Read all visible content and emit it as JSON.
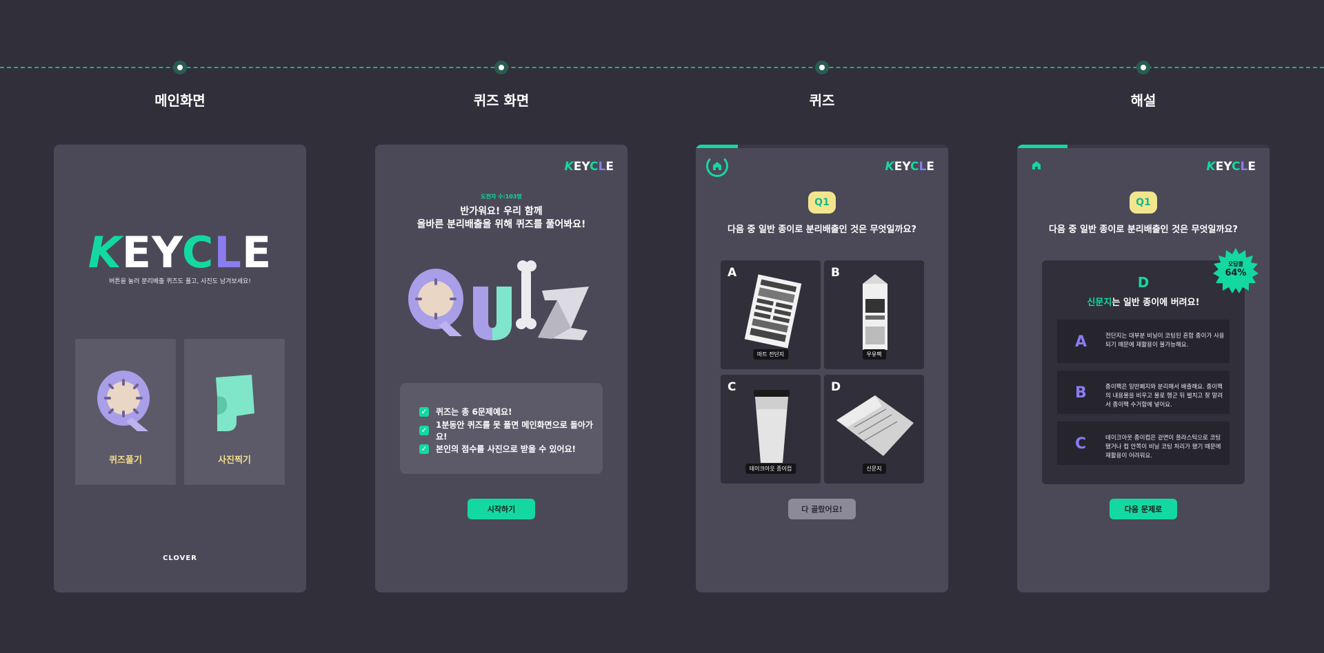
{
  "steps": [
    {
      "title": "메인화면"
    },
    {
      "title": "퀴즈 화면"
    },
    {
      "title": "퀴즈"
    },
    {
      "title": "해설"
    }
  ],
  "brand": {
    "logo_k": "K",
    "logo_ey": "EY",
    "logo_c": "C",
    "logo_l": "L",
    "logo_e": "E",
    "accent": "#13d9a1",
    "purple": "#8b7cf0",
    "yellow": "#f5dd8a"
  },
  "main_screen": {
    "tagline": "버튼을 눌러 분리배출 퀴즈도 풀고, 사진도 남겨보세요!",
    "quiz_button": "퀴즈풀기",
    "photo_button": "사진찍기",
    "footer": "CLOVER"
  },
  "quiz_intro": {
    "challenger": "도전자 수:103명",
    "greeting_line1": "반가워요! 우리 함께",
    "greeting_line2": "올바른 분리배출을 위해 퀴즈를 풀어봐요!",
    "hero_text": "Quiz",
    "rules": [
      "퀴즈는 총 6문제예요!",
      "1분동안 퀴즈를 못 풀면 메인화면으로 돌아가요!",
      "본인의 점수를 사진으로 받을 수 있어요!"
    ],
    "start_button": "시작하기"
  },
  "quiz": {
    "badge": "Q1",
    "question": "다음 중 일반 종이로 분리배출인 것은 무엇일까요?",
    "options": [
      {
        "letter": "A",
        "label": "마트 전단지"
      },
      {
        "letter": "B",
        "label": "우유팩"
      },
      {
        "letter": "C",
        "label": "테이크아웃 종이컵"
      },
      {
        "letter": "D",
        "label": "신문지"
      }
    ],
    "done_button": "다 골랐어요!"
  },
  "explanation": {
    "badge": "Q1",
    "question": "다음 중 일반 종이로 분리배출인 것은 무엇일까요?",
    "correct_rate_label": "오답률",
    "correct_rate_value": "64%",
    "answer_letter": "D",
    "answer_highlight": "신문지",
    "answer_rest": "는 일반 종이에 버려요!",
    "items": [
      {
        "letter": "A",
        "text": "전단지는 대부분 비닐이 코팅된 혼합 종이가 사용되기 때문에 재활용이 불가능해요."
      },
      {
        "letter": "B",
        "text": "종이팩은 일반폐지와 분리해서 배출해요. 종이팩의 내용물을 비우고 물로 헹군 뒤 펼치고 잘 말려서 종이팩 수거함에 넣어요."
      },
      {
        "letter": "C",
        "text": "테이크아웃 종이컵은 겉면이 플라스틱으로 코팅됐거나 컵 안쪽이 비닐 코팅 처리가 됐기 때문에 재활용이 어려워요."
      }
    ],
    "next_button": "다음 문제로"
  }
}
